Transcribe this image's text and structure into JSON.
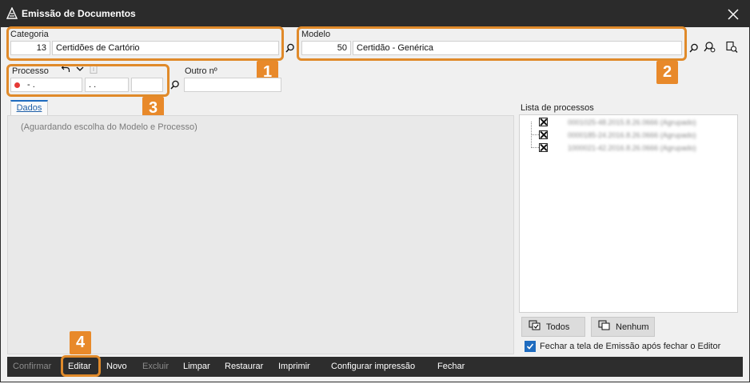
{
  "window": {
    "title": "Emissão de Documentos"
  },
  "categoria": {
    "label": "Categoria",
    "code": "13",
    "name": "Certidões de Cartório"
  },
  "modelo": {
    "label": "Modelo",
    "code": "50",
    "name": "Certidão - Genérica"
  },
  "processo": {
    "label": "Processo",
    "part1": "- .",
    "part2": ". .",
    "part3": ""
  },
  "outro": {
    "label": "Outro nº",
    "value": ""
  },
  "tabs": {
    "dados": "Dados"
  },
  "dados": {
    "hint": "(Aguardando escolha do Modelo e Processo)"
  },
  "lista": {
    "title": "Lista de processos",
    "items": [
      {
        "text": "0001025-48.2015.8.26.0666 (Agrupado)",
        "checked": true
      },
      {
        "text": "0000185-24.2016.8.26.0666 (Agrupado)",
        "checked": true
      },
      {
        "text": "1000021-42.2016.8.26.0666 (Agrupado)",
        "checked": true
      }
    ],
    "todos_label": "Todos",
    "nenhum_label": "Nenhum"
  },
  "close_editor": {
    "label": "Fechar a tela de Emissão após fechar o Editor",
    "checked": true
  },
  "footer": {
    "confirmar": "Confirmar",
    "editar": "Editar",
    "novo": "Novo",
    "excluir": "Excluir",
    "limpar": "Limpar",
    "restaurar": "Restaurar",
    "imprimir": "Imprimir",
    "configurar": "Configurar impressão",
    "fechar": "Fechar"
  },
  "callouts": {
    "c1": "1",
    "c2": "2",
    "c3": "3",
    "c4": "4"
  },
  "colors": {
    "accent": "#1e6bbf",
    "callout": "#e8892a",
    "titlebar": "#2b2b2b",
    "required_dot": "#e53935"
  },
  "icons": [
    "app-icon",
    "close-icon",
    "search-icon",
    "search-settings-icon",
    "search-check-icon",
    "undo-icon",
    "chevron-down-icon",
    "info-icon",
    "checkbox-icon",
    "select-all-icon",
    "select-none-icon"
  ]
}
